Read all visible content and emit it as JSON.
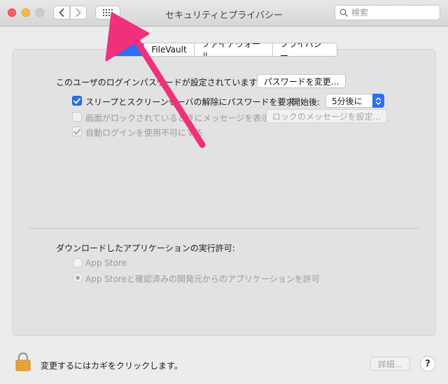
{
  "window": {
    "title": "セキュリティとプライバシー",
    "search_placeholder": "検索"
  },
  "tabs": [
    {
      "label": "",
      "active": true
    },
    {
      "label": "FileVault",
      "active": false
    },
    {
      "label": "ファイアウォール",
      "active": false
    },
    {
      "label": "プライバシー",
      "active": false
    }
  ],
  "general": {
    "password_set_label": "このユーザのログインパスワードが設定されています",
    "change_password_button": "パスワードを変更...",
    "require_password_label": "スリープとスクリーンセーバの解除にパスワードを要求",
    "require_password_checked": true,
    "start_after_label": "開始後:",
    "start_after_value": "5分後に",
    "lock_message_label": "画面がロックされているときにメッセージを表示",
    "lock_message_checked": false,
    "lock_message_button": "ロックのメッセージを設定...",
    "disable_autologin_label": "自動ログインを使用不可にする",
    "disable_autologin_checked": true
  },
  "downloads": {
    "heading": "ダウンロードしたアプリケーションの実行許可:",
    "option_app_store": "App Store",
    "option_app_store_identified": "App Storeと確認済みの開発元からのアプリケーションを許可",
    "selected": "option_app_store_identified"
  },
  "footer": {
    "lock_text": "変更するにはカギをクリックします。",
    "advanced_button": "詳細...",
    "help_label": "?"
  },
  "colors": {
    "accent": "#2a6ff6",
    "annotation_arrow": "#f0307a"
  },
  "icons": {
    "back": "chevron-left-icon",
    "forward": "chevron-right-icon",
    "show_all": "grid-icon",
    "search": "magnifier-icon",
    "lock": "padlock-icon",
    "annotation": "pink-arrow-icon"
  }
}
